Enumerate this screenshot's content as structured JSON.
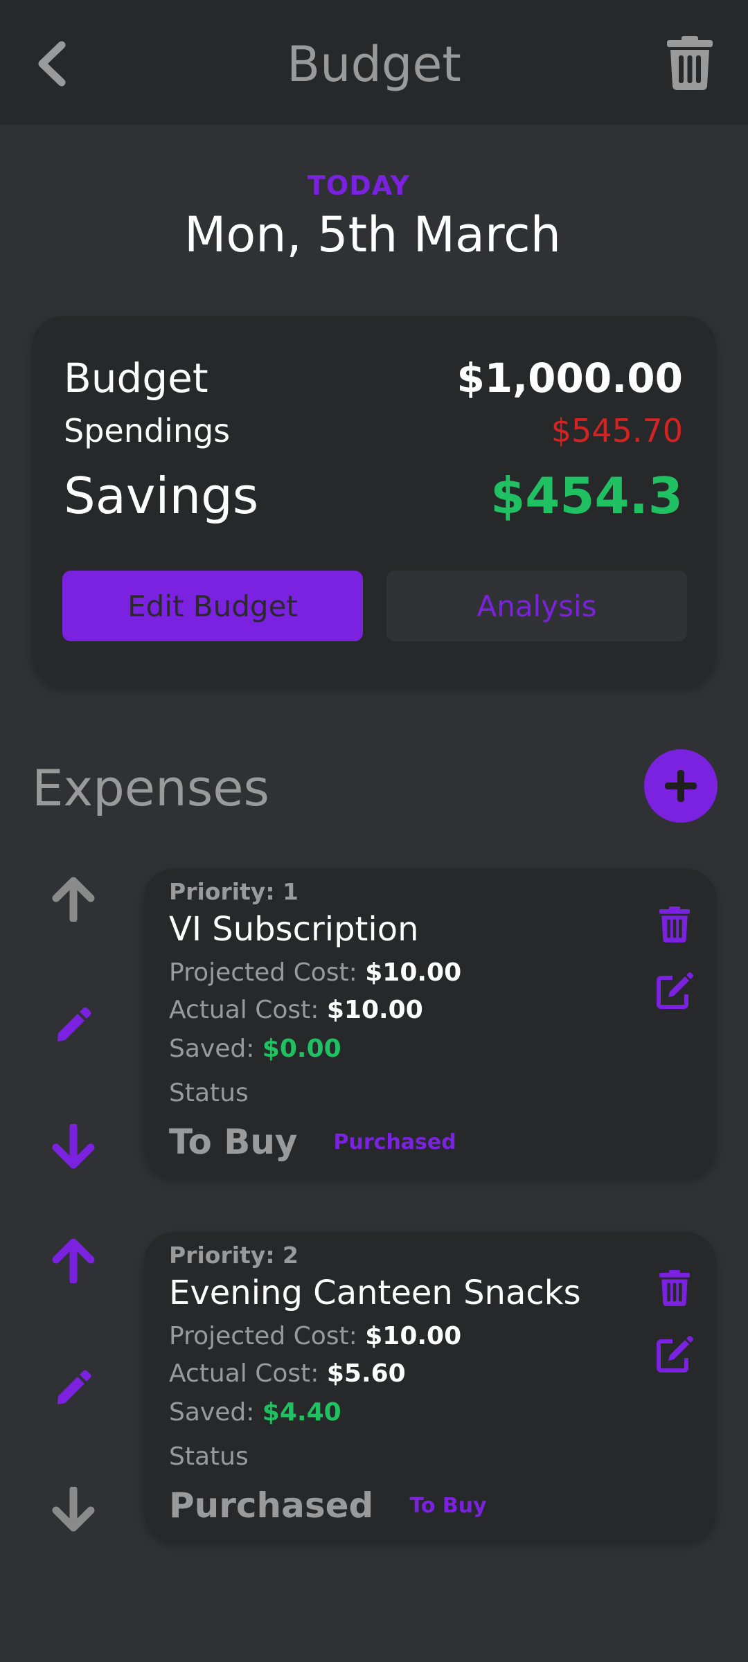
{
  "appbar": {
    "title": "Budget",
    "back_icon": "chevron-left-icon",
    "delete_icon": "trash-icon"
  },
  "header": {
    "today_label": "TODAY",
    "date": "Mon, 5th March"
  },
  "summary": {
    "budget_label": "Budget",
    "budget_value": "$1,000.00",
    "spendings_label": "Spendings",
    "spendings_value": "$545.70",
    "savings_label": "Savings",
    "savings_value": "$454.3",
    "edit_button": "Edit Budget",
    "analysis_button": "Analysis"
  },
  "expenses": {
    "title": "Expenses",
    "add_icon": "plus-icon",
    "items": [
      {
        "priority": "Priority: 1",
        "name": "VI Subscription",
        "projected_label": "Projected Cost: ",
        "projected_value": "$10.00",
        "actual_label": "Actual Cost: ",
        "actual_value": "$10.00",
        "saved_label": "Saved: ",
        "saved_value": "$0.00",
        "status_label": "Status",
        "status_value": "To Buy",
        "status_action": "Purchased",
        "up_enabled": false,
        "down_enabled": true
      },
      {
        "priority": "Priority: 2",
        "name": "Evening Canteen Snacks",
        "projected_label": "Projected Cost: ",
        "projected_value": "$10.00",
        "actual_label": "Actual Cost: ",
        "actual_value": "$5.60",
        "saved_label": "Saved: ",
        "saved_value": "$4.40",
        "status_label": "Status",
        "status_value": "Purchased",
        "status_action": "To Buy",
        "up_enabled": true,
        "down_enabled": false
      }
    ]
  },
  "colors": {
    "accent": "#7a22e0",
    "positive": "#1fc163",
    "negative": "#d42323",
    "muted": "#9a9a9a",
    "background": "#2f3134",
    "surface": "#27282a"
  }
}
